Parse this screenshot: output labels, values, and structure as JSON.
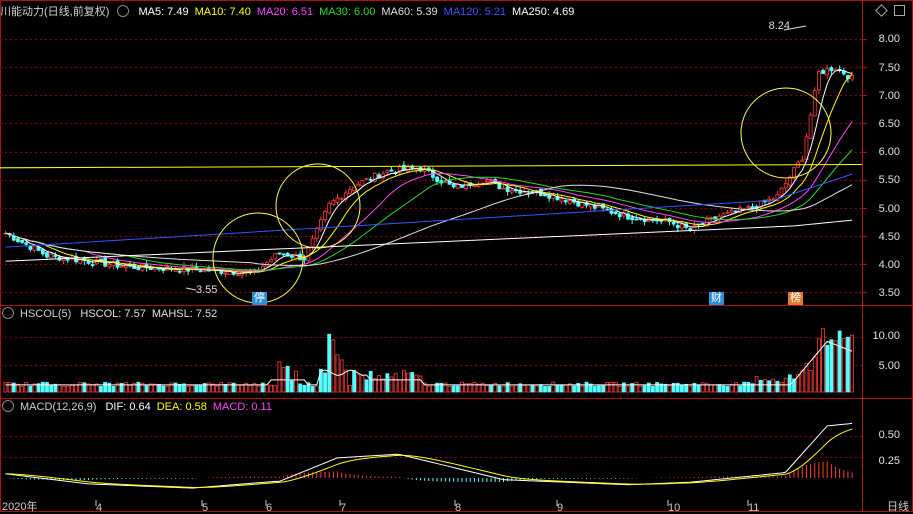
{
  "main_header": {
    "title": "川能动力(日线,前复权)",
    "ma": [
      {
        "label": "MA5: 7.49",
        "color": "#ffffff"
      },
      {
        "label": "MA10: 7.40",
        "color": "#ffff00"
      },
      {
        "label": "MA20: 6.51",
        "color": "#ff44ff"
      },
      {
        "label": "MA30: 6.00",
        "color": "#22dd22"
      },
      {
        "label": "MA60: 5.39",
        "color": "#e0e0e0"
      },
      {
        "label": "MA120: 5.21",
        "color": "#3355ff"
      },
      {
        "label": "MA250: 4.69",
        "color": "#ffffff"
      }
    ]
  },
  "hscol_header": {
    "title": "HSCOL(5)",
    "items": [
      {
        "label": "HSCOL: 7.57",
        "color": "#e0e0e0"
      },
      {
        "label": "MAHSL: 7.52",
        "color": "#e0e0e0"
      }
    ]
  },
  "macd_header": {
    "title": "MACD(12,26,9)",
    "items": [
      {
        "label": "DIF: 0.64",
        "color": "#ffffff"
      },
      {
        "label": "DEA: 0.58",
        "color": "#ffff00"
      },
      {
        "label": "MACD: 0.11",
        "color": "#ff44ff"
      }
    ]
  },
  "price_axis": [
    "8.00",
    "7.50",
    "7.00",
    "6.50",
    "6.00",
    "5.50",
    "5.00",
    "4.50",
    "4.00",
    "3.50"
  ],
  "hscol_axis": [
    "10.00",
    "5.00"
  ],
  "macd_axis": [
    "0.50",
    "0.25"
  ],
  "annotations": {
    "high": "8.24",
    "low": "3.55"
  },
  "badges": [
    {
      "text": "停",
      "color": "#2a8fd6"
    },
    {
      "text": "财",
      "color": "#2a8fd6"
    },
    {
      "text": "榜",
      "color": "#e07b2a"
    }
  ],
  "x_labels": [
    "2020年",
    "4",
    "5",
    "6",
    "7",
    "8",
    "9",
    "10",
    "11"
  ],
  "corner_label": "日线",
  "colors": {
    "up": "#ff3b3b",
    "down": "#54ffff",
    "grid": "#8b0000",
    "frame": "#b01010"
  }
}
